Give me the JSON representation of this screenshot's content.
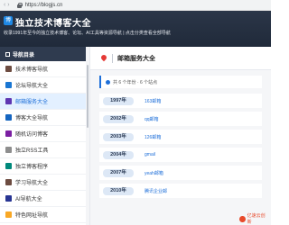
{
  "browser": {
    "nav": "‹ ›",
    "url": "https://blogjs.cn"
  },
  "header": {
    "logo_text": "博",
    "title": "独立技术博客大全",
    "subtitle": "收录1991年至今的独立技术博客、论坛、AI工具等资源导航 | 点击分类查看全部导航"
  },
  "sidebar": {
    "heading": "导航目录",
    "items": [
      {
        "label": "技术博客导航",
        "color": "#6d4c41"
      },
      {
        "label": "论坛导航大全",
        "color": "#1976d2"
      },
      {
        "label": "邮箱服务大全",
        "color": "#5e35b1",
        "active": true
      },
      {
        "label": "博客大全导航",
        "color": "#1565c0"
      },
      {
        "label": "随机访问博客",
        "color": "#7b1fa2"
      },
      {
        "label": "独立RSS工具",
        "color": "#8e8e8e"
      },
      {
        "label": "独立博客程序",
        "color": "#00897b"
      },
      {
        "label": "学习导航大全",
        "color": "#6d4c41"
      },
      {
        "label": "AI导航大全",
        "color": "#283593"
      },
      {
        "label": "特色网址导航",
        "color": "#f9a825"
      }
    ]
  },
  "main": {
    "title": "邮箱服务大全",
    "stats": "共 6 个年份 · 6 个站点",
    "rows": [
      {
        "year": "1997年",
        "site": "163邮箱"
      },
      {
        "year": "2002年",
        "site": "qq邮箱"
      },
      {
        "year": "2003年",
        "site": "126邮箱"
      },
      {
        "year": "2004年",
        "site": "gmail"
      },
      {
        "year": "2007年",
        "site": "yeah邮箱"
      },
      {
        "year": "2010年",
        "site": "腾讯企业邮"
      }
    ]
  },
  "watermark": {
    "text": "亿速云创新"
  },
  "colors": {
    "header_bg": "#202a3a",
    "accent": "#1e6fd9",
    "active_bg": "#e3f0ff"
  }
}
